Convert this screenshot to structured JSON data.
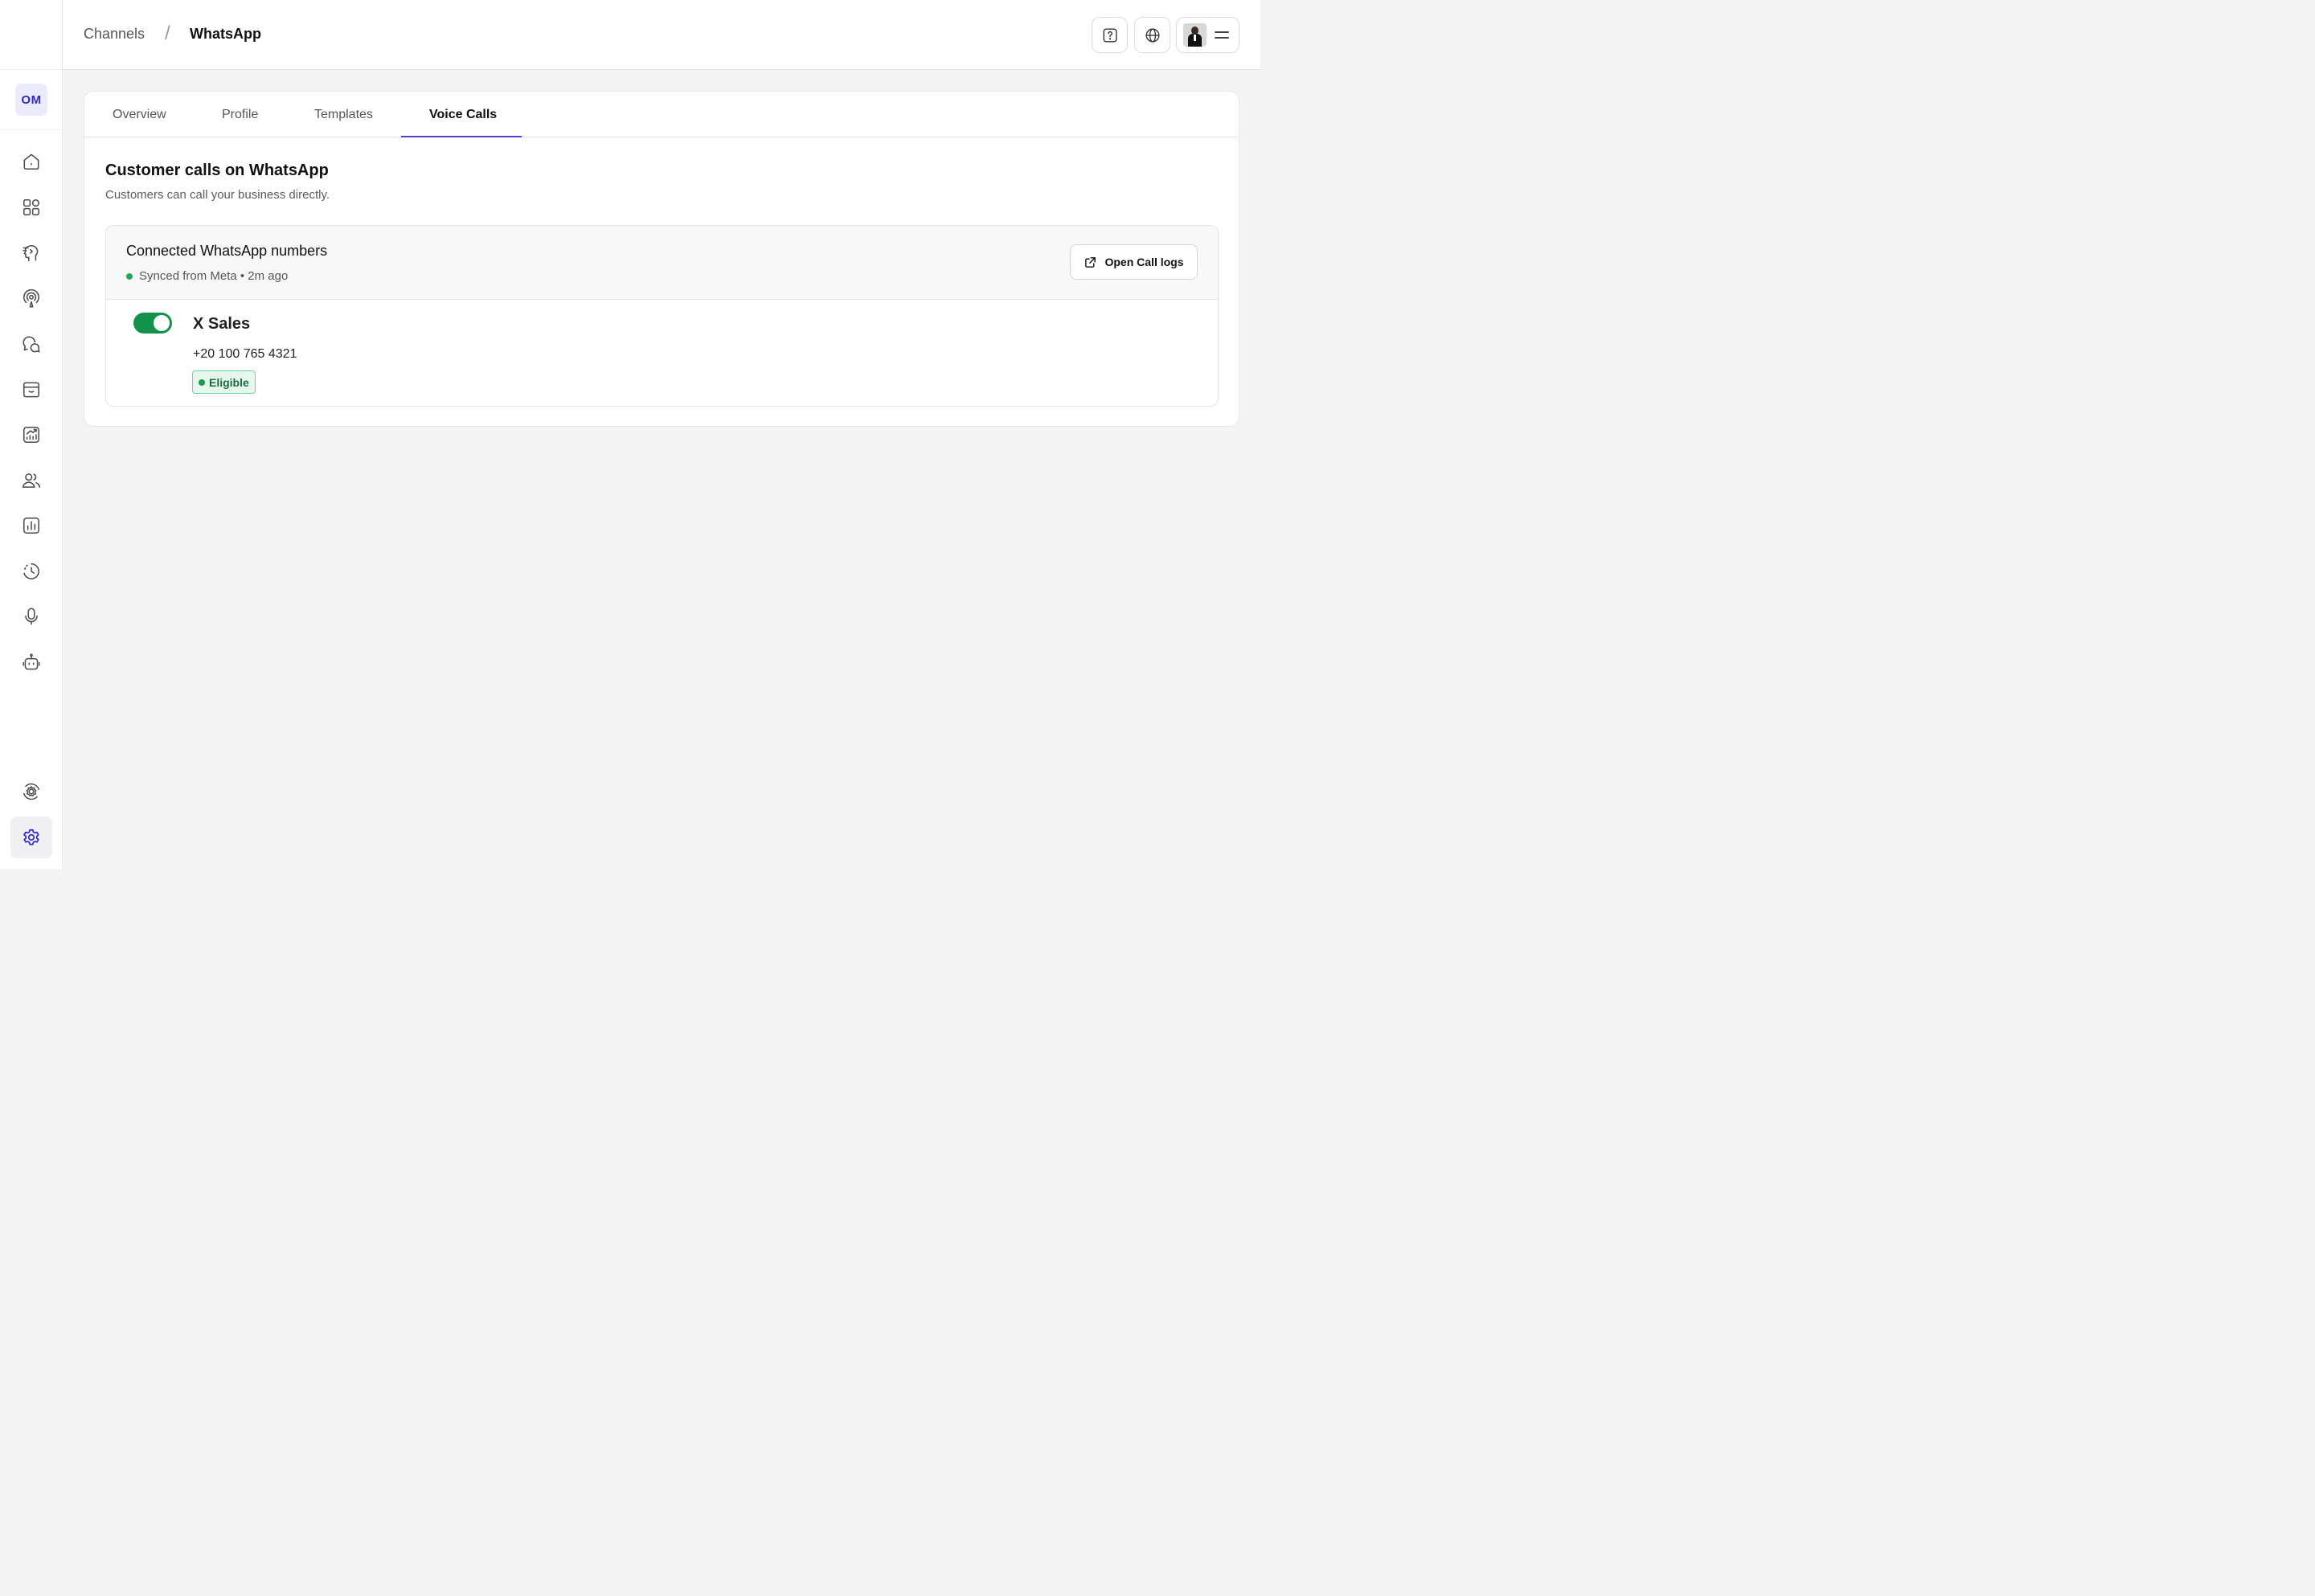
{
  "workspace": {
    "initials": "OM"
  },
  "breadcrumb": {
    "parent": "Channels",
    "separator": "/",
    "current": "WhatsApp"
  },
  "header": {
    "icons": [
      "help-icon",
      "globe-icon",
      "menu-icon"
    ]
  },
  "sidebar": {
    "items": [
      {
        "name": "home-icon"
      },
      {
        "name": "apps-icon"
      },
      {
        "name": "ai-brain-icon"
      },
      {
        "name": "broadcast-icon"
      },
      {
        "name": "chat-icon"
      },
      {
        "name": "store-icon"
      },
      {
        "name": "growth-chart-icon"
      },
      {
        "name": "contacts-icon"
      },
      {
        "name": "reports-icon"
      },
      {
        "name": "history-icon"
      },
      {
        "name": "microphone-icon"
      },
      {
        "name": "bot-icon"
      },
      {
        "name": "integrations-settings-icon"
      },
      {
        "name": "settings-icon",
        "active": true
      }
    ]
  },
  "tabs": [
    {
      "label": "Overview"
    },
    {
      "label": "Profile"
    },
    {
      "label": "Templates"
    },
    {
      "label": "Voice Calls",
      "active": true
    }
  ],
  "section": {
    "title": "Customer calls on WhatsApp",
    "subtitle": "Customers can call your business directly."
  },
  "numbers": {
    "title": "Connected WhatsApp numbers",
    "sync_status": "Synced from Meta • 2m ago",
    "open_logs_label": "Open Call logs",
    "items": [
      {
        "name": "X Sales",
        "phone": "+20 100 765 4321",
        "enabled": true,
        "status": "Eligible"
      }
    ]
  },
  "colors": {
    "accent": "#4a44d6",
    "success": "#12924a",
    "badge_bg": "#e6f8ee"
  }
}
